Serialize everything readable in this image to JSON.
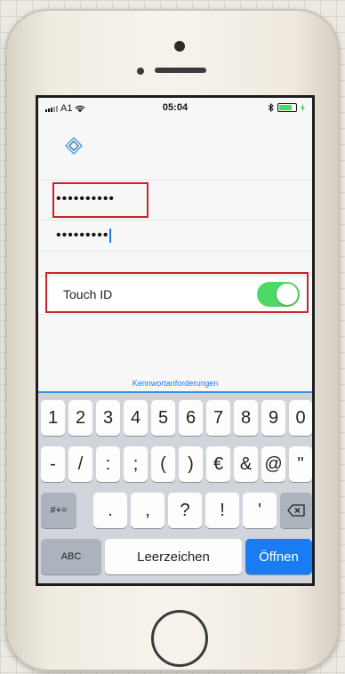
{
  "status": {
    "carrier": "A1",
    "time": "05:04"
  },
  "fields": {
    "password1": "••••••••••",
    "password2": "•••••••••"
  },
  "touch_id": {
    "label": "Touch ID",
    "enabled": true
  },
  "link": {
    "requirements": "Kennwortanforderungen"
  },
  "keyboard": {
    "row1": [
      "1",
      "2",
      "3",
      "4",
      "5",
      "6",
      "7",
      "8",
      "9",
      "0"
    ],
    "row2": [
      "-",
      "/",
      ":",
      ";",
      "(",
      ")",
      "€",
      "&",
      "@",
      "\""
    ],
    "row3": {
      "shift": "#+=",
      "keys": [
        ".",
        ",",
        "?",
        "!",
        "'"
      ]
    },
    "row4": {
      "abc": "ABC",
      "space": "Leerzeichen",
      "go": "Öffnen"
    }
  },
  "colors": {
    "toggle_on": "#4cd964",
    "accent": "#1a7cf2",
    "highlight": "#c9232c"
  }
}
